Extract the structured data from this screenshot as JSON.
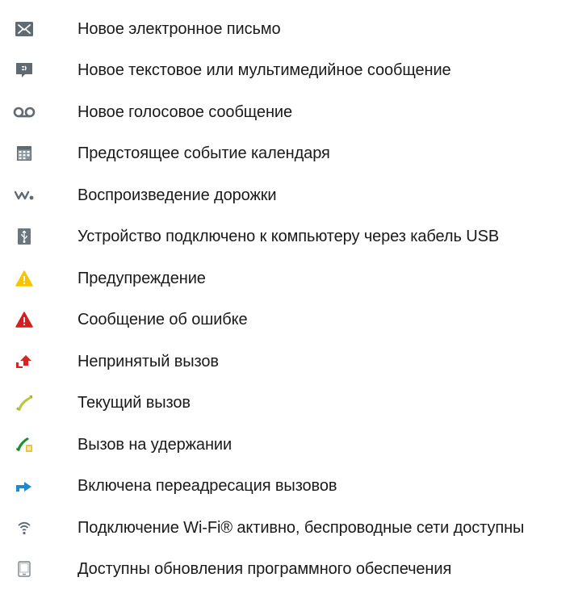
{
  "items": [
    {
      "icon": "envelope-icon",
      "label": "Новое электронное письмо"
    },
    {
      "icon": "message-bubble-icon",
      "label": "Новое текстовое или мультимедийное сообщение"
    },
    {
      "icon": "voicemail-icon",
      "label": "Новое голосовое сообщение"
    },
    {
      "icon": "calendar-icon",
      "label": "Предстоящее событие календаря"
    },
    {
      "icon": "walkman-icon",
      "label": "Воспроизведение дорожки"
    },
    {
      "icon": "usb-icon",
      "label": "Устройство подключено к компьютеру через кабель USB"
    },
    {
      "icon": "warning-yellow-icon",
      "label": "Предупреждение"
    },
    {
      "icon": "error-red-icon",
      "label": "Сообщение об ошибке"
    },
    {
      "icon": "missed-call-icon",
      "label": "Непринятый вызов"
    },
    {
      "icon": "ongoing-call-icon",
      "label": "Текущий вызов"
    },
    {
      "icon": "call-on-hold-icon",
      "label": "Вызов на удержании"
    },
    {
      "icon": "call-forwarding-icon",
      "label": "Включена переадресация вызовов"
    },
    {
      "icon": "wifi-icon",
      "label": "Подключение Wi-Fi® активно, беспроводные сети доступны"
    },
    {
      "icon": "software-update-icon",
      "label": "Доступны обновления программного обеспечения"
    }
  ],
  "colors": {
    "icon_gray": "#5f6a72",
    "warning_yellow": "#f6c400",
    "error_red": "#d3201f",
    "missed_call_red": "#d62525",
    "call_green_light": "#b9c53d",
    "call_green_dark": "#1f8b2a",
    "forward_blue": "#1e88d1",
    "text": "#1a1a1a"
  }
}
